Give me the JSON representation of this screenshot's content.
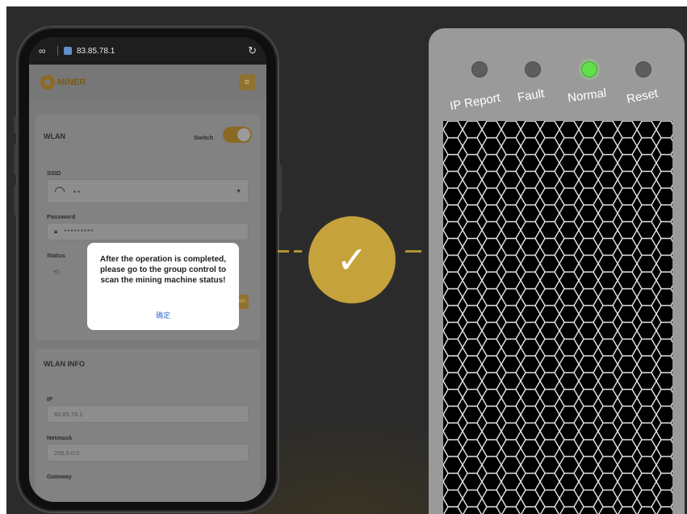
{
  "browser": {
    "url": "83.85.78.1"
  },
  "app": {
    "logo_text": "MINER",
    "menu_icon": "menu-icon"
  },
  "wlan": {
    "title": "WLAN",
    "switch_label": "Switch",
    "switch_on": true,
    "ssid_label": "SSID",
    "ssid_value": "▪ ▪",
    "password_label": "Password",
    "password_value": "*********",
    "status_label": "Status",
    "action_label": "ction"
  },
  "dialog": {
    "message": "After the operation is completed, please go to the group control to scan the mining machine status!",
    "confirm": "确定"
  },
  "wlan_info": {
    "title": "WLAN INFO",
    "ip_label": "IP",
    "ip_value": "83.85.78.1",
    "netmask_label": "Netmask",
    "netmask_value": "255.0.0.0",
    "gateway_label": "Gateway"
  },
  "connector": {
    "check_icon": "check-icon",
    "check_glyph": "✓"
  },
  "miner": {
    "indicators": [
      {
        "label": "IP Report",
        "on": false
      },
      {
        "label": "Fault",
        "on": false
      },
      {
        "label": "Normal",
        "on": true
      },
      {
        "label": "Reset",
        "on": false
      }
    ]
  },
  "colors": {
    "accent_gold": "#c6a23c",
    "led_green": "#62e04a",
    "background": "#2c2c2c"
  }
}
